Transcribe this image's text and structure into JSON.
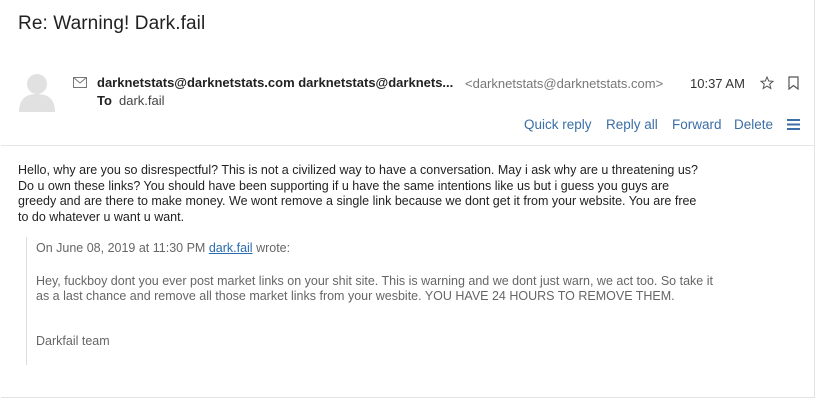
{
  "email": {
    "subject": "Re: Warning! Dark.fail",
    "from_names": "darknetstats@darknetstats.com darknetstats@darknets...",
    "from_address": "<darknetstats@darknetstats.com>",
    "time": "10:37 AM",
    "to_label": "To",
    "to_value": "dark.fail"
  },
  "actions": {
    "quick_reply": "Quick reply",
    "reply_all": "Reply all",
    "forward": "Forward",
    "delete": "Delete"
  },
  "body": {
    "text": "Hello, why are you so disrespectful? This is not a civilized way to have a conversation. May i ask why are u threatening us? Do u own these links? You should have been supporting if u have the same intentions like us but i guess you guys are greedy and are there to make money. We wont remove a single link because we dont get it from your website. You are free to do whatever u want u want."
  },
  "quote": {
    "header_prefix": "On June 08, 2019 at 11:30 PM ",
    "header_link": "dark.fail",
    "header_suffix": " wrote:",
    "text": "Hey, fuckboy dont you ever post market links on your shit site. This is warning and we dont just warn, we act too. So take it as a last chance and remove all those market links from your wesbite. YOU HAVE 24 HOURS TO REMOVE THEM.",
    "signature": "Darkfail team"
  },
  "icons": {
    "avatar": "person-avatar-icon",
    "mail": "envelope-icon",
    "star": "star-icon",
    "bookmark": "bookmark-icon",
    "menu": "hamburger-menu-icon"
  },
  "colors": {
    "link": "#3b6fa6",
    "quote_text": "#666666"
  }
}
